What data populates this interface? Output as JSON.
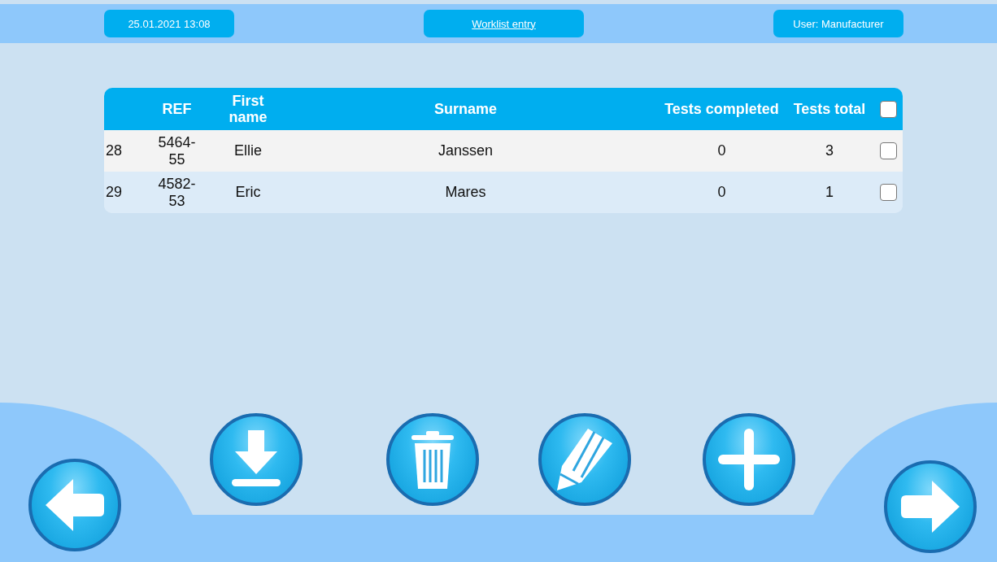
{
  "header": {
    "date": "25.01.2021 13:08",
    "title": "Worklist entry",
    "user": "User: Manufacturer"
  },
  "table": {
    "columns": [
      "REF",
      "First name",
      "Surname",
      "Tests completed",
      "Tests total"
    ],
    "all_checked": false,
    "rows": [
      {
        "number": "28",
        "ref": "5464-55",
        "first_name": "Ellie",
        "surname": "Janssen",
        "tests_completed": "0",
        "tests_total": "3",
        "checked": false
      },
      {
        "number": "29",
        "ref": "4582-53",
        "first_name": "Eric",
        "surname": "Mares",
        "tests_completed": "0",
        "tests_total": "1",
        "checked": false
      }
    ]
  },
  "buttons": [
    {
      "kind": "back"
    },
    {
      "kind": "download"
    },
    {
      "kind": "delete"
    },
    {
      "kind": "edit"
    },
    {
      "kind": "add"
    },
    {
      "kind": "next"
    }
  ]
}
